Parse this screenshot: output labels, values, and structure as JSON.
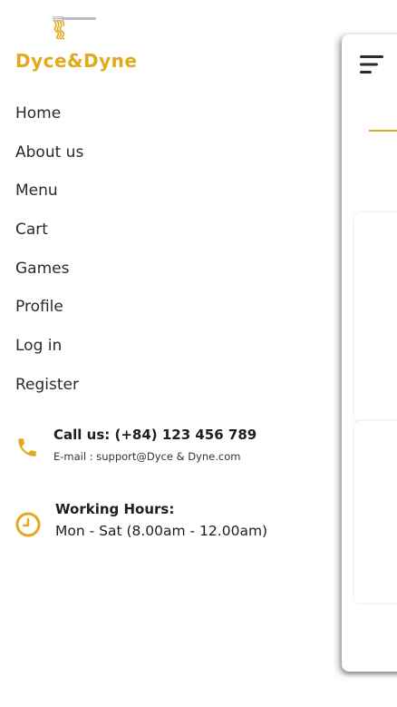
{
  "brand": {
    "name": "Dyce&Dyne",
    "accent_color": "#e2a91c",
    "logo_icon": "fork-with-noodles-icon"
  },
  "nav": {
    "items": [
      {
        "label": "Home"
      },
      {
        "label": "About us"
      },
      {
        "label": "Menu"
      },
      {
        "label": "Cart"
      },
      {
        "label": "Games"
      },
      {
        "label": "Profile"
      },
      {
        "label": "Log in"
      },
      {
        "label": "Register"
      }
    ]
  },
  "contact": {
    "call_label": "Call us: (+84) 123 456 789",
    "email_label": "E-mail : support@Dyce & Dyne.com",
    "icon": "phone-icon"
  },
  "hours": {
    "title": "Working Hours:",
    "value": "Mon - Sat (8.00am - 12.00am)",
    "icon": "clock-icon"
  },
  "drawer": {
    "menu_icon": "hamburger-menu-icon"
  }
}
